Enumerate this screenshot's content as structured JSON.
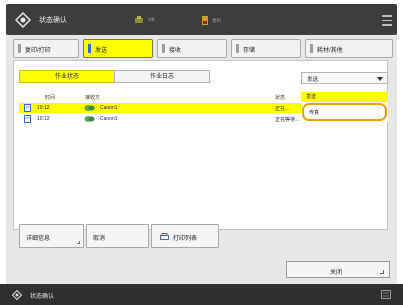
{
  "header": {
    "title": "状态确认",
    "status1_text": "ⅠⅡⅢ",
    "status2_text": "墨粉"
  },
  "tabs": [
    {
      "label": "复印/打印"
    },
    {
      "label": "发送"
    },
    {
      "label": "接收"
    },
    {
      "label": "存储"
    },
    {
      "label": "耗材/其他"
    }
  ],
  "subtabs": {
    "active": "作业状态",
    "inactive": "作业日志"
  },
  "filter": {
    "selected": "发送",
    "options": [
      "发送",
      "传真"
    ]
  },
  "table": {
    "columns": {
      "time": "时间",
      "dest": "接收方",
      "status": "状态"
    },
    "rows": [
      {
        "time": "10:12",
        "dest": "Canon1",
        "status": "正在…"
      },
      {
        "time": "10:12",
        "dest": "Canon1",
        "status": "正在等待…"
      }
    ]
  },
  "buttons": {
    "details": "详细信息",
    "cancel": "取消",
    "print_list": "打印列表",
    "close": "关闭"
  },
  "statusbar": {
    "title": "状态确认"
  },
  "colors": {
    "accent": "#ffff00",
    "highlight": "#f0a000",
    "header_bg": "#3d3d3d"
  }
}
